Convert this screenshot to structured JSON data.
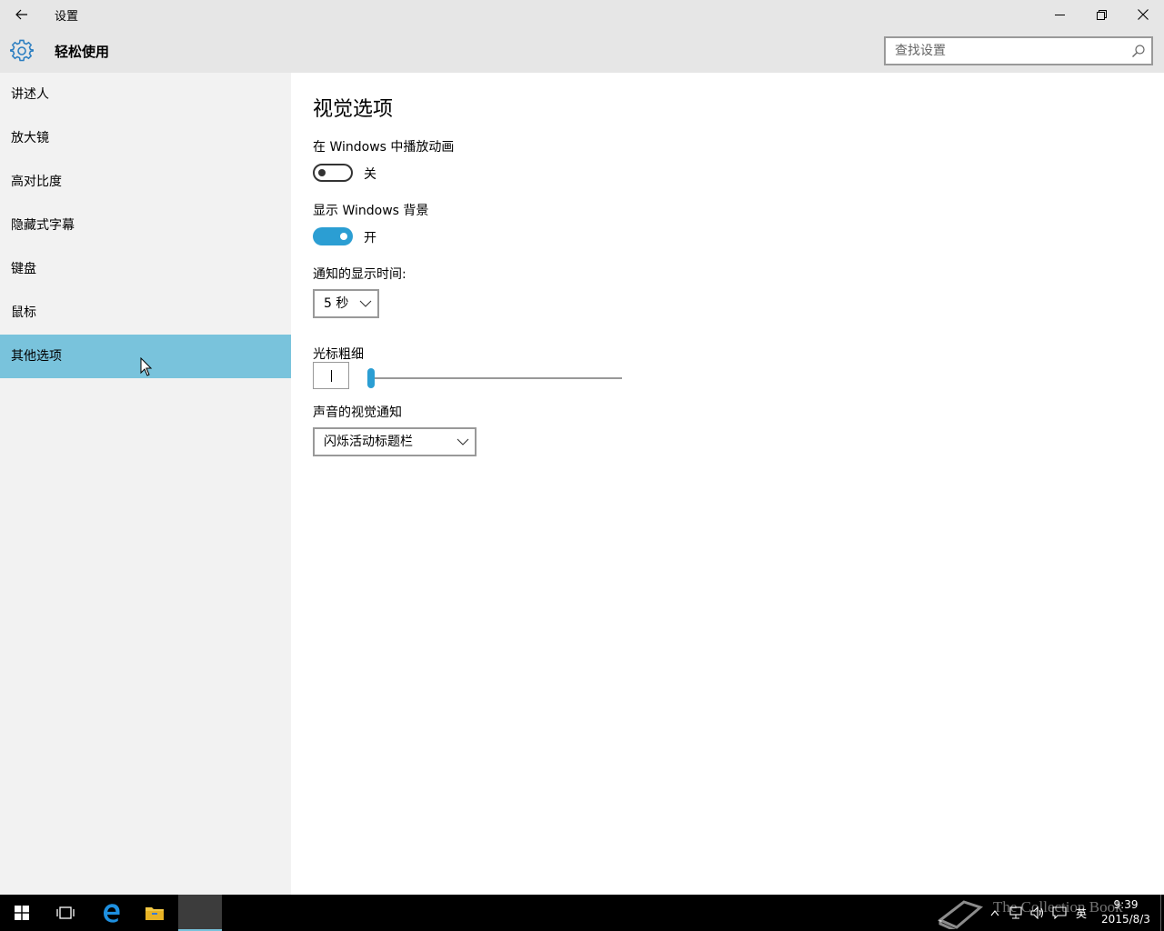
{
  "window": {
    "title": "设置",
    "controls": [
      "minimize-icon",
      "restore-icon",
      "close-icon"
    ]
  },
  "header": {
    "heading": "轻松使用",
    "search_placeholder": "查找设置"
  },
  "sidebar": {
    "items": [
      {
        "label": "讲述人"
      },
      {
        "label": "放大镜"
      },
      {
        "label": "高对比度"
      },
      {
        "label": "隐藏式字幕"
      },
      {
        "label": "键盘"
      },
      {
        "label": "鼠标"
      },
      {
        "label": "其他选项",
        "active": true
      }
    ]
  },
  "main": {
    "section_title": "视觉选项",
    "animations": {
      "label": "在 Windows 中播放动画",
      "state": "关",
      "on": false
    },
    "background": {
      "label": "显示 Windows 背景",
      "state": "开",
      "on": true
    },
    "notification_time": {
      "label": "通知的显示时间:",
      "value": "5 秒"
    },
    "cursor_thickness": {
      "label": "光标粗细",
      "value_fraction": 0.0
    },
    "visual_sound": {
      "label": "声音的视觉通知",
      "value": "闪烁活动标题栏"
    }
  },
  "taskbar": {
    "input_language": "英",
    "time": "9:39",
    "date": "2015/8/3",
    "watermark": "The Collection Book"
  },
  "colors": {
    "accent": "#2b9ed3",
    "selection": "#79c3dc",
    "chrome": "#e6e6e6",
    "sidebar": "#f2f2f2"
  }
}
